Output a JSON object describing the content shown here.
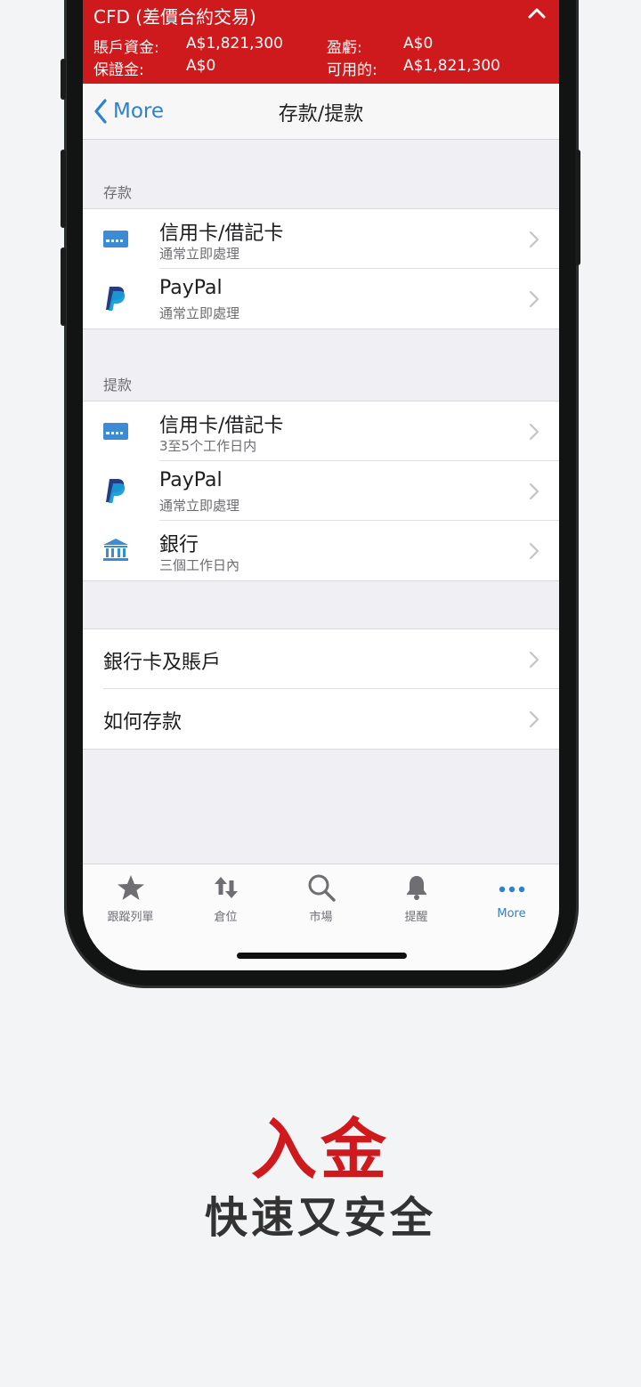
{
  "banner": {
    "title": "CFD (差價合約交易)",
    "balance_label": "賬戶資金:",
    "balance_value": "A$1,821,300",
    "pnl_label": "盈虧:",
    "pnl_value": "A$0",
    "margin_label": "保證金:",
    "margin_value": "A$0",
    "available_label": "可用的:",
    "available_value": "A$1,821,300"
  },
  "nav": {
    "back_label": "More",
    "title": "存款/提款"
  },
  "deposit": {
    "header": "存款",
    "items": [
      {
        "title": "信用卡/借記卡",
        "subtitle": "通常立即處理",
        "icon": "credit-card-icon"
      },
      {
        "title": "PayPal",
        "subtitle": "通常立即處理",
        "icon": "paypal-icon"
      }
    ]
  },
  "withdraw": {
    "header": "提款",
    "items": [
      {
        "title": "信用卡/借記卡",
        "subtitle": "3至5个工作日内",
        "icon": "credit-card-icon"
      },
      {
        "title": "PayPal",
        "subtitle": "通常立即處理",
        "icon": "paypal-icon"
      },
      {
        "title": "銀行",
        "subtitle": "三個工作日內",
        "icon": "bank-icon"
      }
    ]
  },
  "other": {
    "items": [
      {
        "title": "銀行卡及賬戶"
      },
      {
        "title": "如何存款"
      }
    ]
  },
  "tabs": [
    {
      "label": "跟蹤列單",
      "icon": "star-icon"
    },
    {
      "label": "倉位",
      "icon": "arrows-up-down-icon"
    },
    {
      "label": "市場",
      "icon": "search-icon"
    },
    {
      "label": "提醒",
      "icon": "bell-icon"
    },
    {
      "label": "More",
      "icon": "more-dots-icon",
      "active": true
    }
  ],
  "promo": {
    "headline": "入金",
    "subline": "快速又安全"
  },
  "colors": {
    "brand_red": "#cf1a1d",
    "link_blue": "#2f80d0",
    "paypal_dark": "#253b80",
    "paypal_light": "#179bd7"
  }
}
